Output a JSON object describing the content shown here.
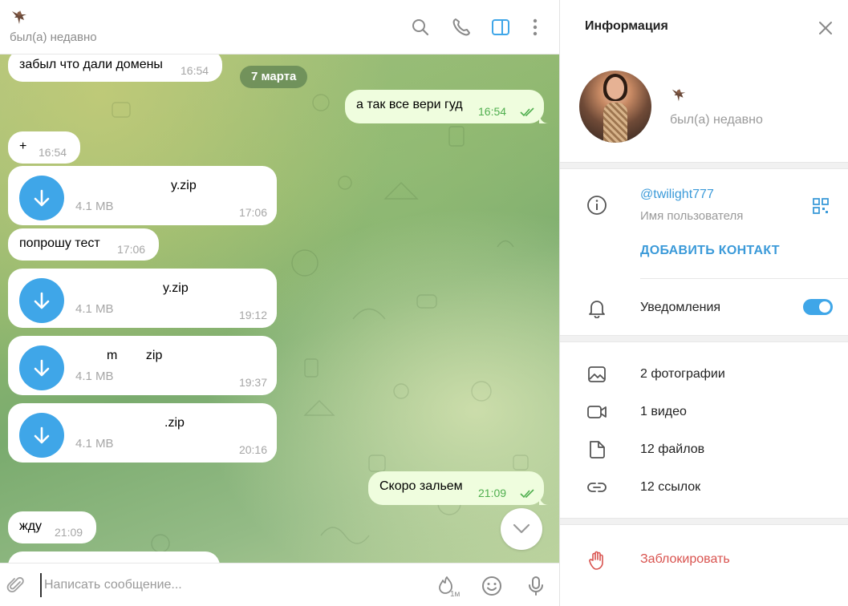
{
  "chat": {
    "header": {
      "status": "был(а) недавно",
      "icons": [
        "search-icon",
        "phone-icon",
        "sidebar-toggle-icon",
        "more-vertical-icon"
      ],
      "accent_color": "#3fa6e8"
    },
    "date_separator": "7 марта",
    "messages": [
      {
        "dir": "in",
        "text": "забыл что дали домены",
        "time": "16:54"
      },
      {
        "dir": "out",
        "text": "а так все вери гуд",
        "time": "16:54"
      },
      {
        "dir": "in",
        "text": "+",
        "time": "16:54"
      },
      {
        "dir": "in",
        "type": "file",
        "name": "y.zip",
        "size": "4.1 MB",
        "time": "17:06"
      },
      {
        "dir": "in",
        "text": "попрошу тест",
        "time": "17:06"
      },
      {
        "dir": "in",
        "type": "file",
        "name": "y.zip",
        "size": "4.1 MB",
        "time": "19:12"
      },
      {
        "dir": "in",
        "type": "file",
        "name": "m        zip",
        "size": "4.1 MB",
        "time": "19:37"
      },
      {
        "dir": "in",
        "type": "file",
        "name": ".zip",
        "size": "4.1 MB",
        "time": "20:16"
      },
      {
        "dir": "out",
        "text": "Скоро зальем",
        "time": "21:09"
      },
      {
        "dir": "in",
        "text": "жду",
        "time": "21:09"
      }
    ],
    "composer": {
      "placeholder": "Написать сообщение...",
      "timer_label": "1м"
    }
  },
  "info_panel": {
    "title": "Информация",
    "status": "был(а) недавно",
    "username": "@twilight777",
    "username_label": "Имя пользователя",
    "add_contact": "ДОБАВИТЬ КОНТАКТ",
    "notifications_label": "Уведомления",
    "notifications_enabled": true,
    "media": {
      "photos": "2 фотографии",
      "videos": "1 видео",
      "files": "12 файлов",
      "links": "12 ссылок"
    },
    "block": "Заблокировать",
    "block_color": "#d9534f"
  }
}
